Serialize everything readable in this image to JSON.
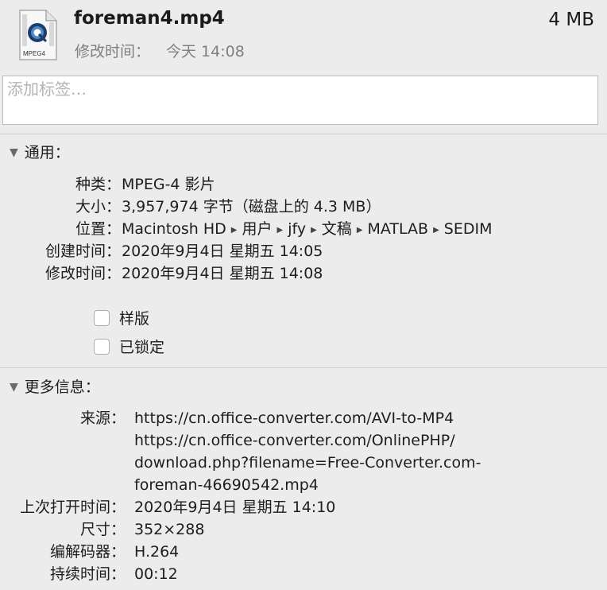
{
  "header": {
    "file_name": "foreman4.mp4",
    "file_size": "4 MB",
    "modified_label": "修改时间：",
    "modified_value": "今天 14:08",
    "icon_text": "MPEG4"
  },
  "tags": {
    "placeholder": "添加标签…"
  },
  "general": {
    "title": "通用：",
    "kind_label": "种类：",
    "kind_value": "MPEG-4 影片",
    "size_label": "大小：",
    "size_value": "3,957,974 字节（磁盘上的 4.3 MB）",
    "where_label": "位置：",
    "where_path": [
      "Macintosh HD",
      "用户",
      "jfy",
      "文稿",
      "MATLAB",
      "SEDIM"
    ],
    "created_label": "创建时间：",
    "created_value": "2020年9月4日 星期五 14:05",
    "modified_label": "修改时间：",
    "modified_value": "2020年9月4日 星期五 14:08",
    "stationery_label": "样版",
    "locked_label": "已锁定"
  },
  "more_info": {
    "title": "更多信息：",
    "source_label": "来源：",
    "source_lines": [
      "https://cn.office-converter.com/AVI-to-MP4",
      "https://cn.office-converter.com/OnlinePHP/",
      "download.php?filename=Free-Converter.com-",
      "foreman-46690542.mp4"
    ],
    "last_opened_label": "上次打开时间：",
    "last_opened_value": "2020年9月4日 星期五 14:10",
    "dimensions_label": "尺寸：",
    "dimensions_value": "352×288",
    "codecs_label": "编解码器：",
    "codecs_value": "H.264",
    "duration_label": "持续时间：",
    "duration_value": "00:12"
  }
}
